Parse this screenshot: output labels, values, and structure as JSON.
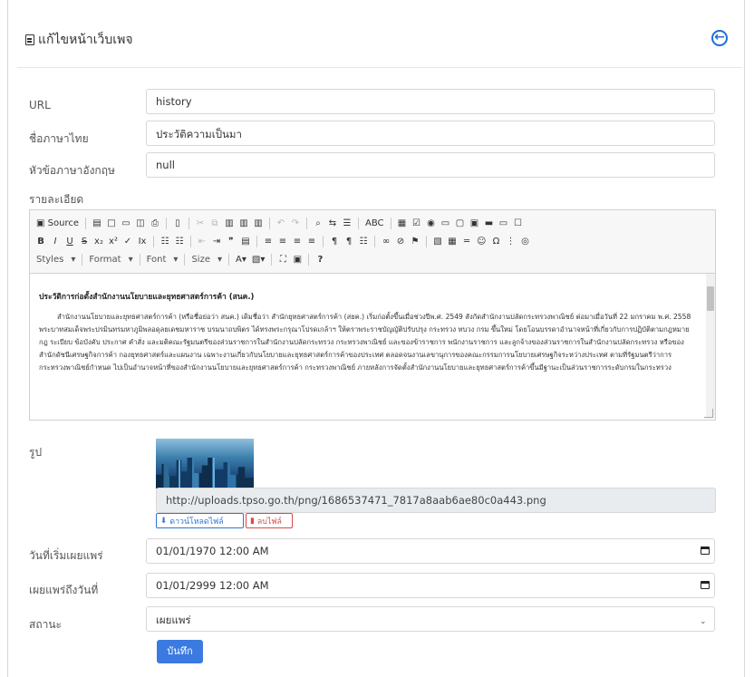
{
  "header": {
    "title": "แก้ไขหน้าเว็บเพจ",
    "back_icon": "arrow-left-circle-icon"
  },
  "fields": {
    "url": {
      "label": "URL",
      "value": "history"
    },
    "thai_name": {
      "label": "ชื่อภาษาไทย",
      "value": "ประวัติความเป็นมา"
    },
    "english_name": {
      "label": "หัวข้อภาษาอังกฤษ",
      "value": "null"
    },
    "details": {
      "label": "รายละเอียด"
    },
    "image": {
      "label": "รูป",
      "path": "http://uploads.tpso.go.th/png/1686537471_7817a8aab6ae80c0a443.png",
      "download": "ดาวน์โหลดไฟล์",
      "delete": "ลบไฟล์"
    },
    "publish_start": {
      "label": "วันที่เริ่มเผยแพร่",
      "value": "01/01/1970 12:00 AM"
    },
    "publish_end": {
      "label": "เผยแพร่ถึงวันที่",
      "value": "01/01/2999 12:00 AM"
    },
    "status": {
      "label": "สถานะ",
      "value": "เผยแพร่"
    }
  },
  "editor": {
    "toolbar": {
      "source": "Source",
      "styles": "Styles",
      "format": "Format",
      "font": "Font",
      "size": "Size",
      "help": "?"
    },
    "content_title": "ประวัติการก่อตั้งสำนักงานนโยบายและยุทธศาสตร์การค้า (สนค.)",
    "paragraph": "สำนักงานนโยบายและยุทธศาสตร์การค้า (หรือชื่อย่อว่า สนค.) เดิมชื่อว่า สำนักยุทธศาสตร์การค้า (สยค.) เริ่มก่อตั้งขึ้นเมื่อช่วงปีพ.ศ. 2549 สังกัดสำนักงานปลัดกระทรวงพาณิชย์ ต่อมาเมื่อวันที่ 22 มกราคม พ.ศ. 2558 พระบาทสมเด็จพระปรมินทรมหาภูมิพลอดุลยเดชมหาราช บรมนาถบพิตร ได้ทรงพระกรุณาโปรดเกล้าฯ ให้ตราพระราชบัญญัติปรับปรุง กระทรวง ทบวง กรม ขึ้นใหม่ โดยโอนบรรดาอำนาจหน้าที่เกี่ยวกับการปฏิบัติตามกฎหมาย กฎ ระเบียบ ข้อบังคับ ประกาศ คำสั่ง และมติคณะรัฐมนตรีของส่วนราชการในสำนักงานปลัดกระทรวง กระทรวงพาณิชย์ และของข้าราชการ พนักงานราชการ และลูกจ้างของส่วนราชการในสำนักงานปลัดกระทรวง หรือของสำนักดัชนีเศรษฐกิจการค้า กองยุทธศาสตร์และแผนงาน เฉพาะงานเกี่ยวกับนโยบายและยุทธศาสตร์การค้าของประเทศ ตลอดจนงานเลขานุการของคณะกรรมการนโยบายเศรษฐกิจระหว่างประเทศ ตามที่รัฐมนตรีว่าการกระทรวงพาณิชย์กำหนด ไปเป็นอำนาจหน้าที่ของสำนักงานนโยบายและยุทธศาสตร์การค้า กระทรวงพาณิชย์ ภายหลังการจัดตั้งสำนักงานนโยบายและยุทธศาสตร์การค้าขึ้นมีฐานะเป็นส่วนราชการระดับกรมในกระทรวง"
  },
  "actions": {
    "save": "บันทึก"
  }
}
